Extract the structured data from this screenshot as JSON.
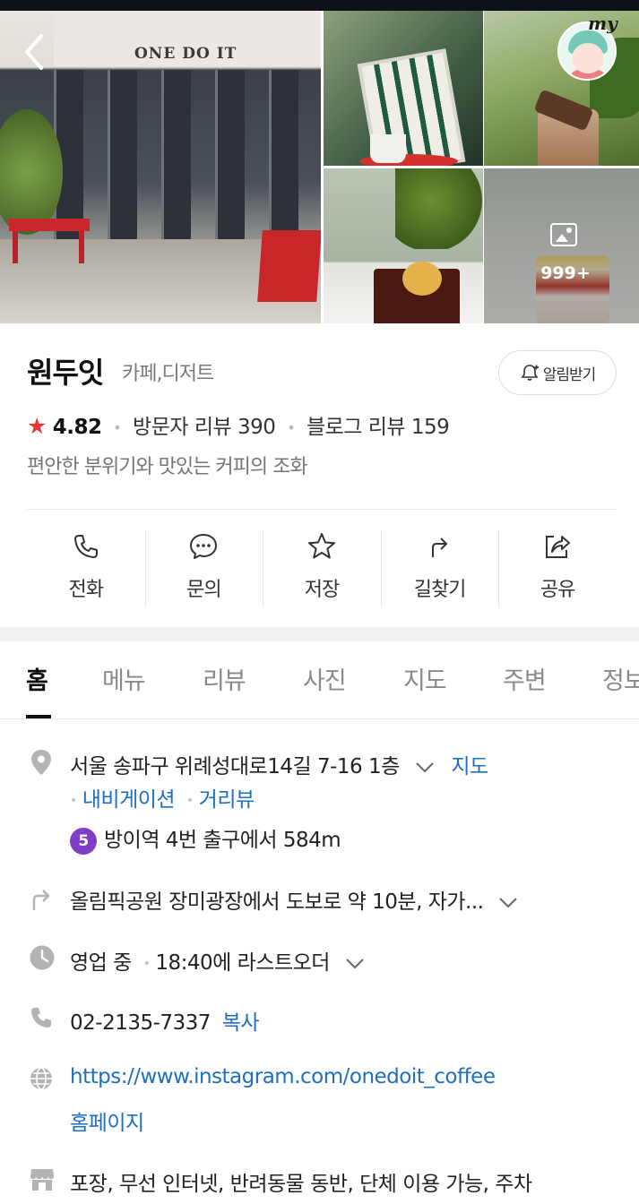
{
  "gallery": {
    "brand_sign": "ONE DO IT",
    "more_photos_count": "999+",
    "user_badge": "my"
  },
  "place": {
    "name": "원두잇",
    "category": "카페,디저트",
    "notify_label": "알림받기",
    "rating": "4.82",
    "visitor_reviews": "방문자 리뷰 390",
    "blog_reviews": "블로그 리뷰 159",
    "description": "편안한 분위기와 맛있는 커피의 조화"
  },
  "actions": [
    {
      "label": "전화",
      "icon": "phone-icon"
    },
    {
      "label": "문의",
      "icon": "chat-icon"
    },
    {
      "label": "저장",
      "icon": "star-icon"
    },
    {
      "label": "길찾기",
      "icon": "directions-icon"
    },
    {
      "label": "공유",
      "icon": "share-icon"
    }
  ],
  "tabs": [
    {
      "label": "홈",
      "active": true
    },
    {
      "label": "메뉴"
    },
    {
      "label": "리뷰"
    },
    {
      "label": "사진"
    },
    {
      "label": "지도"
    },
    {
      "label": "주변"
    },
    {
      "label": "정보"
    }
  ],
  "info": {
    "address": "서울 송파구 위례성대로14길 7-16 1층",
    "map_link": "지도",
    "navigation_link": "내비게이션",
    "street_view_link": "거리뷰",
    "subway_line": "5",
    "subway_text": "방이역 4번 출구에서 584m",
    "directions_text": "올림픽공원 장미광장에서 도보로 약 10분, 자가...",
    "hours_status": "영업 중",
    "hours_text": "18:40에 라스트오더",
    "phone": "02-2135-7337",
    "copy_label": "복사",
    "website": "https://www.instagram.com/onedoit_coffee",
    "homepage_label": "홈페이지",
    "amenities": "포장, 무선 인터넷, 반려동물 동반, 단체 이용 가능, 주차"
  },
  "colors": {
    "star": "#e8363a",
    "link": "#1e6fc0",
    "subway_line5": "#7f3ec6"
  }
}
